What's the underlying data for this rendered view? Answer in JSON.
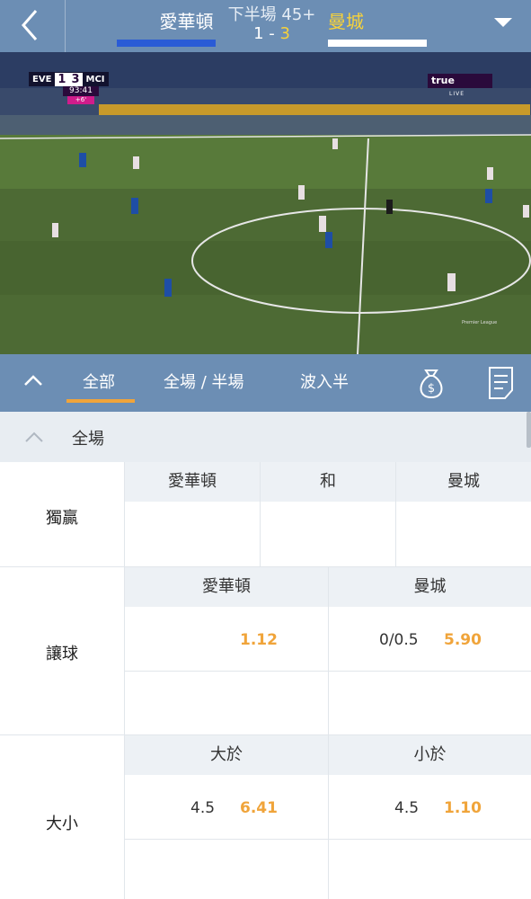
{
  "header": {
    "home_team": "愛華頓",
    "away_team": "曼城",
    "period": "下半場 45+",
    "home_score": "1",
    "score_sep": "-",
    "away_score": "3",
    "colors": {
      "bar": "#6c8eb4",
      "home": "#2a5bd6",
      "away": "#ffffff",
      "away_text": "#f7d23a"
    }
  },
  "video": {
    "home_abbr": "EVE",
    "away_abbr": "MCI",
    "home_score": "1",
    "away_score": "3",
    "clock": "93:41",
    "added_time": "+6'",
    "broadcaster": "true",
    "live_label": "LIVE",
    "watermark": "Premier League"
  },
  "tabs": {
    "items": [
      "全部",
      "全場 / 半場",
      "波入半"
    ],
    "active": 0,
    "icons": [
      "chevron-up-icon",
      "money-bag-icon",
      "bet-slip-icon"
    ]
  },
  "section": {
    "title": "全場"
  },
  "markets": {
    "win": {
      "name": "獨贏",
      "cols": [
        "愛華頓",
        "和",
        "曼城"
      ]
    },
    "handicap": {
      "name": "讓球",
      "cols": [
        "愛華頓",
        "曼城"
      ],
      "home_line": "",
      "home_odd": "1.12",
      "away_line": "0/0.5",
      "away_odd": "5.90"
    },
    "total": {
      "name": "大小",
      "cols": [
        "大於",
        "小於"
      ],
      "over_line": "4.5",
      "over_odd": "6.41",
      "under_line": "4.5",
      "under_odd": "1.10"
    }
  }
}
